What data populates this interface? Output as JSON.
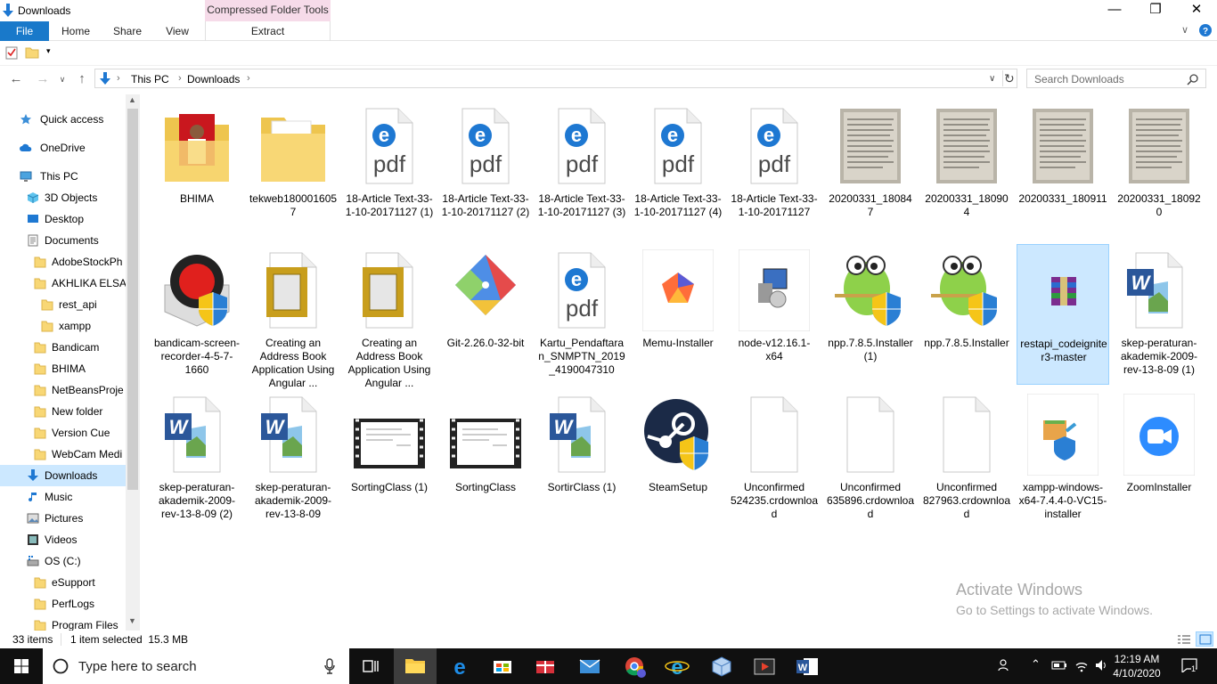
{
  "window": {
    "title": "Downloads",
    "context_label": "Compressed Folder Tools"
  },
  "ribbon": {
    "tabs": [
      "File",
      "Home",
      "Share",
      "View"
    ],
    "extract": "Extract"
  },
  "address": {
    "crumbs": [
      "This PC",
      "Downloads"
    ],
    "search_placeholder": "Search Downloads"
  },
  "nav": [
    {
      "label": "Quick access",
      "icon": "star-icon",
      "indent": 0,
      "group": true
    },
    {
      "label": "OneDrive",
      "icon": "cloud-icon",
      "indent": 0,
      "group": true
    },
    {
      "label": "This PC",
      "icon": "computer-icon",
      "indent": 0,
      "group": true
    },
    {
      "label": "3D Objects",
      "icon": "cube-icon",
      "indent": 1
    },
    {
      "label": "Desktop",
      "icon": "desktop-icon",
      "indent": 1
    },
    {
      "label": "Documents",
      "icon": "document-icon",
      "indent": 1
    },
    {
      "label": "AdobeStockPh",
      "icon": "folder-icon",
      "indent": 2
    },
    {
      "label": "AKHLIKA ELSA",
      "icon": "folder-icon",
      "indent": 2
    },
    {
      "label": "rest_api",
      "icon": "folder-icon",
      "indent": 3
    },
    {
      "label": "xampp",
      "icon": "folder-icon",
      "indent": 3
    },
    {
      "label": "Bandicam",
      "icon": "folder-icon",
      "indent": 2
    },
    {
      "label": "BHIMA",
      "icon": "folder-icon",
      "indent": 2
    },
    {
      "label": "NetBeansProje",
      "icon": "folder-icon",
      "indent": 2
    },
    {
      "label": "New folder",
      "icon": "folder-icon",
      "indent": 2
    },
    {
      "label": "Version Cue",
      "icon": "folder-icon",
      "indent": 2
    },
    {
      "label": "WebCam Medi",
      "icon": "folder-icon",
      "indent": 2
    },
    {
      "label": "Downloads",
      "icon": "download-icon",
      "indent": 1,
      "selected": true
    },
    {
      "label": "Music",
      "icon": "music-icon",
      "indent": 1
    },
    {
      "label": "Pictures",
      "icon": "pictures-icon",
      "indent": 1
    },
    {
      "label": "Videos",
      "icon": "videos-icon",
      "indent": 1
    },
    {
      "label": "OS (C:)",
      "icon": "drive-icon",
      "indent": 1
    },
    {
      "label": "eSupport",
      "icon": "folder-icon",
      "indent": 2
    },
    {
      "label": "PerfLogs",
      "icon": "folder-icon",
      "indent": 2
    },
    {
      "label": "Program Files",
      "icon": "folder-icon",
      "indent": 2
    }
  ],
  "files": [
    {
      "name": "BHIMA",
      "icon": "folder-photo-icon"
    },
    {
      "name": "tekweb1800016057",
      "icon": "folder-icon"
    },
    {
      "name": "18-Article Text-33-1-10-20171127 (1)",
      "icon": "edge-pdf-icon"
    },
    {
      "name": "18-Article Text-33-1-10-20171127 (2)",
      "icon": "edge-pdf-icon"
    },
    {
      "name": "18-Article Text-33-1-10-20171127 (3)",
      "icon": "edge-pdf-icon"
    },
    {
      "name": "18-Article Text-33-1-10-20171127 (4)",
      "icon": "edge-pdf-icon"
    },
    {
      "name": "18-Article Text-33-1-10-20171127",
      "icon": "edge-pdf-icon"
    },
    {
      "name": "20200331_180847",
      "icon": "photo-icon"
    },
    {
      "name": "20200331_180904",
      "icon": "photo-icon"
    },
    {
      "name": "20200331_180911",
      "icon": "photo-icon"
    },
    {
      "name": "20200331_180920",
      "icon": "photo-icon"
    },
    {
      "name": "bandicam-screen-recorder-4-5-7-1660",
      "icon": "bandicam-icon"
    },
    {
      "name": "Creating an Address Book Application Using Angular ...",
      "icon": "frame-file-icon"
    },
    {
      "name": "Creating an Address Book Application Using Angular ...",
      "icon": "frame-file-icon"
    },
    {
      "name": "Git-2.26.0-32-bit",
      "icon": "git-icon"
    },
    {
      "name": "Kartu_Pendaftaran_SNMPTN_2019_4190047310",
      "icon": "edge-pdf-icon"
    },
    {
      "name": "Memu-Installer",
      "icon": "memu-icon"
    },
    {
      "name": "node-v12.16.1-x64",
      "icon": "installer-icon"
    },
    {
      "name": "npp.7.8.5.Installer (1)",
      "icon": "notepadpp-icon"
    },
    {
      "name": "npp.7.8.5.Installer",
      "icon": "notepadpp-icon"
    },
    {
      "name": "restapi_codeigniter3-master",
      "icon": "winrar-icon",
      "selected": true
    },
    {
      "name": "skep-peraturan-akademik-2009-rev-13-8-09 (1)",
      "icon": "word-icon"
    },
    {
      "name": "skep-peraturan-akademik-2009-rev-13-8-09 (2)",
      "icon": "word-icon"
    },
    {
      "name": "skep-peraturan-akademik-2009-rev-13-8-09",
      "icon": "word-icon"
    },
    {
      "name": "SortingClass (1)",
      "icon": "video-icon"
    },
    {
      "name": "SortingClass",
      "icon": "video-icon"
    },
    {
      "name": "SortirClass (1)",
      "icon": "word-icon"
    },
    {
      "name": "SteamSetup",
      "icon": "steam-icon"
    },
    {
      "name": "Unconfirmed 524235.crdownload",
      "icon": "blank-file-icon"
    },
    {
      "name": "Unconfirmed 635896.crdownload",
      "icon": "blank-file-icon"
    },
    {
      "name": "Unconfirmed 827963.crdownload",
      "icon": "blank-file-icon"
    },
    {
      "name": "xampp-windows-x64-7.4.4-0-VC15-installer",
      "icon": "xampp-icon"
    },
    {
      "name": "ZoomInstaller",
      "icon": "zoom-icon"
    }
  ],
  "status": {
    "count": "33 items",
    "selected": "1 item selected  15.3 MB"
  },
  "watermark": {
    "line1": "Activate Windows",
    "line2": "Go to Settings to activate Windows."
  },
  "taskbar": {
    "search_placeholder": "Type here to search",
    "time": "12:19 AM",
    "date": "4/10/2020",
    "notifications": "1"
  },
  "colors": {
    "accent": "#1979ca",
    "selection": "#cce8ff",
    "folder": "#f8d775",
    "taskbar": "#101010"
  }
}
